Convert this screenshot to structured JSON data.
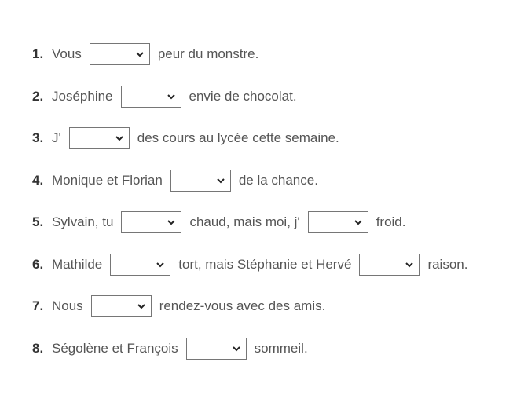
{
  "exercise": {
    "items": [
      {
        "number": "1.",
        "parts": [
          "Vous",
          "peur du monstre."
        ],
        "blanks": 1
      },
      {
        "number": "2.",
        "parts": [
          "Joséphine",
          "envie de chocolat."
        ],
        "blanks": 1
      },
      {
        "number": "3.",
        "parts": [
          "J'",
          "des cours au lycée cette semaine."
        ],
        "blanks": 1
      },
      {
        "number": "4.",
        "parts": [
          "Monique et Florian",
          "de la chance."
        ],
        "blanks": 1
      },
      {
        "number": "5.",
        "parts": [
          "Sylvain, tu",
          "chaud, mais moi, j'",
          "froid."
        ],
        "blanks": 2
      },
      {
        "number": "6.",
        "parts": [
          "Mathilde",
          "tort, mais Stéphanie et Hervé",
          "raison."
        ],
        "blanks": 2
      },
      {
        "number": "7.",
        "parts": [
          "Nous",
          "rendez-vous avec des amis."
        ],
        "blanks": 1
      },
      {
        "number": "8.",
        "parts": [
          "Ségolène et François",
          "sommeil."
        ],
        "blanks": 1
      }
    ],
    "dropdown_selected_value": "",
    "dropdown_icon": "chevron-down-icon"
  },
  "colors": {
    "text": "#555555",
    "number": "#333333",
    "dropdown_border": "#767676",
    "background": "#ffffff"
  }
}
